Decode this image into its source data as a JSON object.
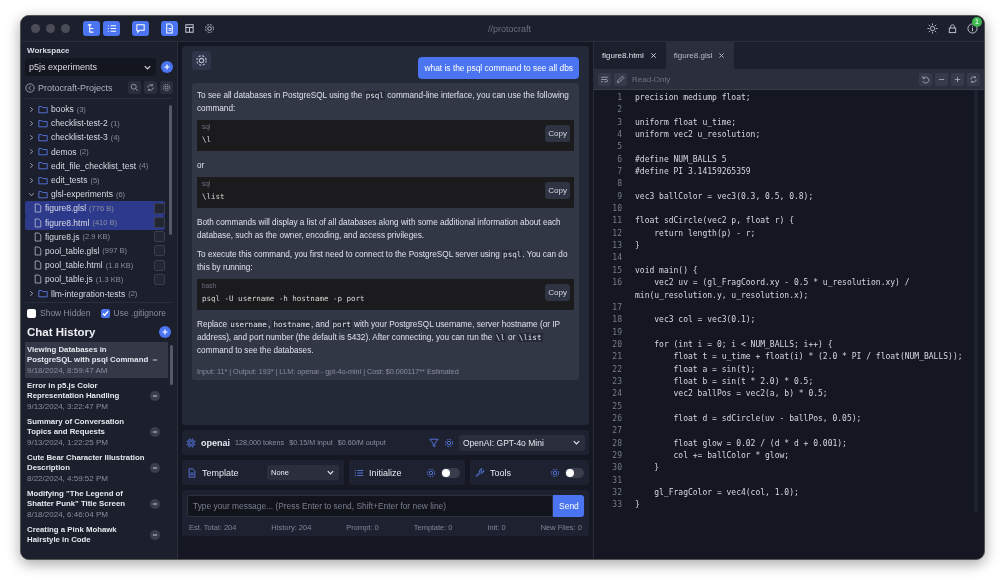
{
  "window": {
    "title": "//protocraft",
    "tools": [
      {
        "on": true
      },
      {
        "on": true
      },
      {
        "on": true
      },
      {
        "on": true
      },
      {
        "on": false
      },
      {
        "on": false
      }
    ],
    "badge": "1"
  },
  "sidebar": {
    "workspace_label": "Workspace",
    "workspace": "p5js experiments",
    "project": "Protocraft-Projects",
    "tree": [
      {
        "name": "books",
        "count": "(3)",
        "expanded": false
      },
      {
        "name": "checklist-test-2",
        "count": "(1)",
        "expanded": false
      },
      {
        "name": "checklist-test-3",
        "count": "(4)",
        "expanded": false
      },
      {
        "name": "demos",
        "count": "(2)",
        "expanded": false
      },
      {
        "name": "edit_file_checklist_test",
        "count": "(4)",
        "expanded": false
      },
      {
        "name": "edit_tests",
        "count": "(5)",
        "expanded": false
      },
      {
        "name": "glsl-experiments",
        "count": "(6)",
        "expanded": true,
        "children": [
          {
            "name": "figure8.glsl",
            "size": "(776 B)",
            "selected": true,
            "checked": false
          },
          {
            "name": "figure8.html",
            "size": "(410 B)",
            "selected": true,
            "checked": false
          },
          {
            "name": "figure8.js",
            "size": "(2.9 KB)",
            "selected": false,
            "checked": false
          },
          {
            "name": "pool_table.glsl",
            "size": "(997 B)",
            "selected": false,
            "checked": false
          },
          {
            "name": "pool_table.html",
            "size": "(1.8 KB)",
            "selected": false,
            "checked": false
          },
          {
            "name": "pool_table.js",
            "size": "(1.3 KB)",
            "selected": false,
            "checked": false
          }
        ]
      },
      {
        "name": "llm-integration-tests",
        "count": "(2)",
        "expanded": false
      }
    ],
    "options": [
      {
        "label": "Show Hidden",
        "checked": false
      },
      {
        "label": "Use .gitignore",
        "checked": true
      }
    ],
    "chat_history_title": "Chat History",
    "chats": [
      {
        "title": "Viewing Databases in PostgreSQL with psql Command",
        "date": "9/18/2024, 8:59:47 AM",
        "selected": true
      },
      {
        "title": "Error in p5.js Color Representation Handling",
        "date": "9/13/2024, 3:22:47 PM",
        "selected": false
      },
      {
        "title": "Summary of Conversation Topics and Requests",
        "date": "9/13/2024, 1:22:25 PM",
        "selected": false
      },
      {
        "title": "Cute Bear Character Illustration Description",
        "date": "8/22/2024, 4:59:52 PM",
        "selected": false
      },
      {
        "title": "Modifying \"The Legend of Shatter Punk\" Title Screen",
        "date": "8/18/2024, 6:46:04 PM",
        "selected": false
      },
      {
        "title": "Creating a Pink Mohawk Hairstyle in Code",
        "selected": false
      }
    ]
  },
  "chat": {
    "user_message": "what is the psql command to see all dbs",
    "blocks": [
      {
        "kind": "paragraph",
        "parts": [
          {
            "text": "To see all databases in PostgreSQL using the "
          },
          {
            "code": "psql"
          },
          {
            "text": " command-line interface, you can use the following command:"
          }
        ]
      },
      {
        "kind": "code",
        "lang": "sql",
        "code": "\\l",
        "button": "Copy"
      },
      {
        "kind": "paragraph",
        "parts": [
          {
            "text": "or"
          }
        ]
      },
      {
        "kind": "code",
        "lang": "sql",
        "code": "\\list",
        "button": "Copy"
      },
      {
        "kind": "paragraph",
        "parts": [
          {
            "text": "Both commands will display a list of all databases along with some additional information about each database, such as the owner, encoding, and access privileges."
          }
        ]
      },
      {
        "kind": "paragraph",
        "parts": [
          {
            "text": "To execute this command, you first need to connect to the PostgreSQL server using "
          },
          {
            "code": "psql"
          },
          {
            "text": ". You can do this by running:"
          }
        ]
      },
      {
        "kind": "code",
        "lang": "bash",
        "code": "psql -U username -h hostname -p port",
        "button": "Copy"
      },
      {
        "kind": "paragraph",
        "parts": [
          {
            "text": "Replace "
          },
          {
            "code": "username"
          },
          {
            "text": ", "
          },
          {
            "code": "hostname"
          },
          {
            "text": ", and "
          },
          {
            "code": "port"
          },
          {
            "text": " with your PostgreSQL username, server hostname (or IP address), and port number (the default is 5432). After connecting, you can run the "
          },
          {
            "code": "\\l"
          },
          {
            "text": " or "
          },
          {
            "code": "\\list"
          },
          {
            "text": " command to see the databases."
          }
        ]
      }
    ],
    "meta": "Input: 11* | Output: 193* | LLM: openai - gpt-4o-mini | Cost: $0.000117** Estimated",
    "model": {
      "provider": "openai",
      "tokens": "128,000 tokens",
      "input_price": "$0.15/M input",
      "output_price": "$0.60/M output",
      "selected": "OpenAI: GPT-4o Mini"
    },
    "template": {
      "label": "Template",
      "value": "None"
    },
    "initialize": {
      "label": "Initialize",
      "on": false
    },
    "tools": {
      "label": "Tools",
      "on": false
    },
    "input_placeholder": "Type your message... (Press Enter to send, Shift+Enter for new line)",
    "send": "Send",
    "stats": [
      "Est. Total: 204",
      "History: 204",
      "Prompt: 0",
      "Template: 0",
      "Init: 0",
      "New Files: 0"
    ]
  },
  "editor": {
    "tabs": [
      {
        "label": "figure8.html",
        "selected": false
      },
      {
        "label": "figure8.glsl",
        "selected": true
      }
    ],
    "mode": "Read-Only",
    "lines": [
      {
        "n": "1",
        "code": "precision mediump float;"
      },
      {
        "n": "2"
      },
      {
        "n": "3",
        "code": "uniform float u_time;"
      },
      {
        "n": "4",
        "code": "uniform vec2 u_resolution;"
      },
      {
        "n": "5"
      },
      {
        "n": "6",
        "code": "#define NUM_BALLS 5"
      },
      {
        "n": "7",
        "code": "#define PI 3.14159265359"
      },
      {
        "n": "8"
      },
      {
        "n": "9",
        "code": "vec3 ballColor = vec3(0.3, 0.5, 0.8);"
      },
      {
        "n": "10"
      },
      {
        "n": "11",
        "code": "float sdCircle(vec2 p, float r) {"
      },
      {
        "n": "12",
        "code": "    return length(p) - r;"
      },
      {
        "n": "13",
        "code": "}"
      },
      {
        "n": "14"
      },
      {
        "n": "15",
        "code": "void main() {"
      },
      {
        "n": "16",
        "code": "    vec2 uv = (gl_FragCoord.xy - 0.5 * u_resolution.xy) / min(u_resolution.y, u_resolution.x);"
      },
      {
        "n": "17"
      },
      {
        "n": "18",
        "code": "    vec3 col = vec3(0.1);"
      },
      {
        "n": "19"
      },
      {
        "n": "20",
        "code": "    for (int i = 0; i < NUM_BALLS; i++) {"
      },
      {
        "n": "21",
        "code": "        float t = u_time + float(i) * (2.0 * PI / float(NUM_BALLS));"
      },
      {
        "n": "22",
        "code": "        float a = sin(t);"
      },
      {
        "n": "23",
        "code": "        float b = sin(t * 2.0) * 0.5;"
      },
      {
        "n": "24",
        "code": "        vec2 ballPos = vec2(a, b) * 0.5;"
      },
      {
        "n": "25"
      },
      {
        "n": "26",
        "code": "        float d = sdCircle(uv - ballPos, 0.05);"
      },
      {
        "n": "27"
      },
      {
        "n": "28",
        "code": "        float glow = 0.02 / (d * d + 0.001);"
      },
      {
        "n": "29",
        "code": "        col += ballColor * glow;"
      },
      {
        "n": "30",
        "code": "    }"
      },
      {
        "n": "31"
      },
      {
        "n": "32",
        "code": "    gl_FragColor = vec4(col, 1.0);"
      },
      {
        "n": "33",
        "code": "}"
      }
    ]
  }
}
